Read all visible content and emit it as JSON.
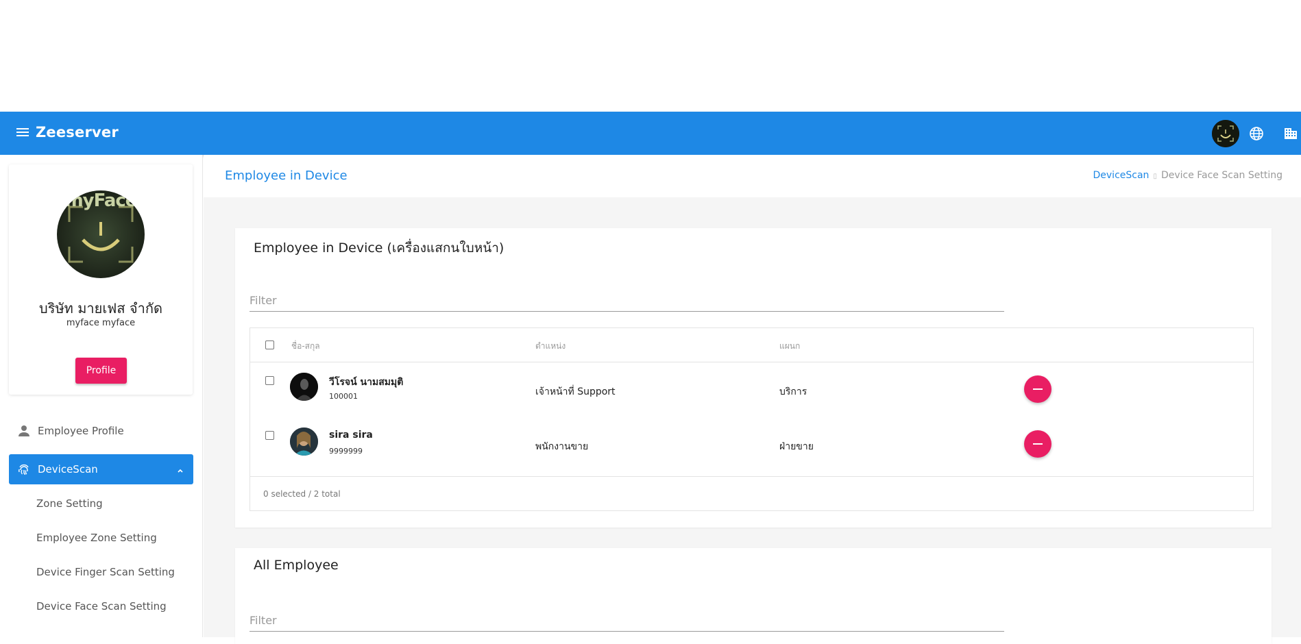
{
  "appbar": {
    "title": "Zeeserver",
    "icons": [
      "menu-icon",
      "user-avatar",
      "globe-icon",
      "building-icon"
    ]
  },
  "sidebar": {
    "profile": {
      "logo_text": "myFace",
      "company_name": "บริษัท มายเฟส จำกัด",
      "user_name": "myface myface",
      "button_label": "Profile"
    },
    "nav": {
      "employee_profile": "Employee Profile",
      "devicescan": "DeviceScan",
      "sub_items": [
        "Zone Setting",
        "Employee Zone Setting",
        "Device Finger Scan Setting",
        "Device Face Scan Setting"
      ]
    }
  },
  "main": {
    "page_title": "Employee in Device",
    "breadcrumb": {
      "parent": "DeviceScan",
      "separator": "▯",
      "current": "Device Face Scan Setting"
    },
    "device_card": {
      "title": "Employee in Device (เครื่องแสกนใบหน้า)",
      "filter_placeholder": "Filter",
      "columns": {
        "name": "ชื่อ-สกุล",
        "position": "ตำแหน่ง",
        "department": "แผนก"
      },
      "rows": [
        {
          "name": "วีโรจน์ นามสมมุติ",
          "code": "100001",
          "position": "เจ้าหน้าที่ Support",
          "department": "บริการ"
        },
        {
          "name": "sira sira",
          "code": "9999999",
          "position": "พนักงานขาย",
          "department": "ฝ่ายขาย"
        }
      ],
      "footer": "0 selected / 2 total"
    },
    "all_card": {
      "title": "All Employee",
      "filter_placeholder": "Filter"
    }
  },
  "colors": {
    "primary": "#1e88e5",
    "accent": "#e91e63"
  }
}
